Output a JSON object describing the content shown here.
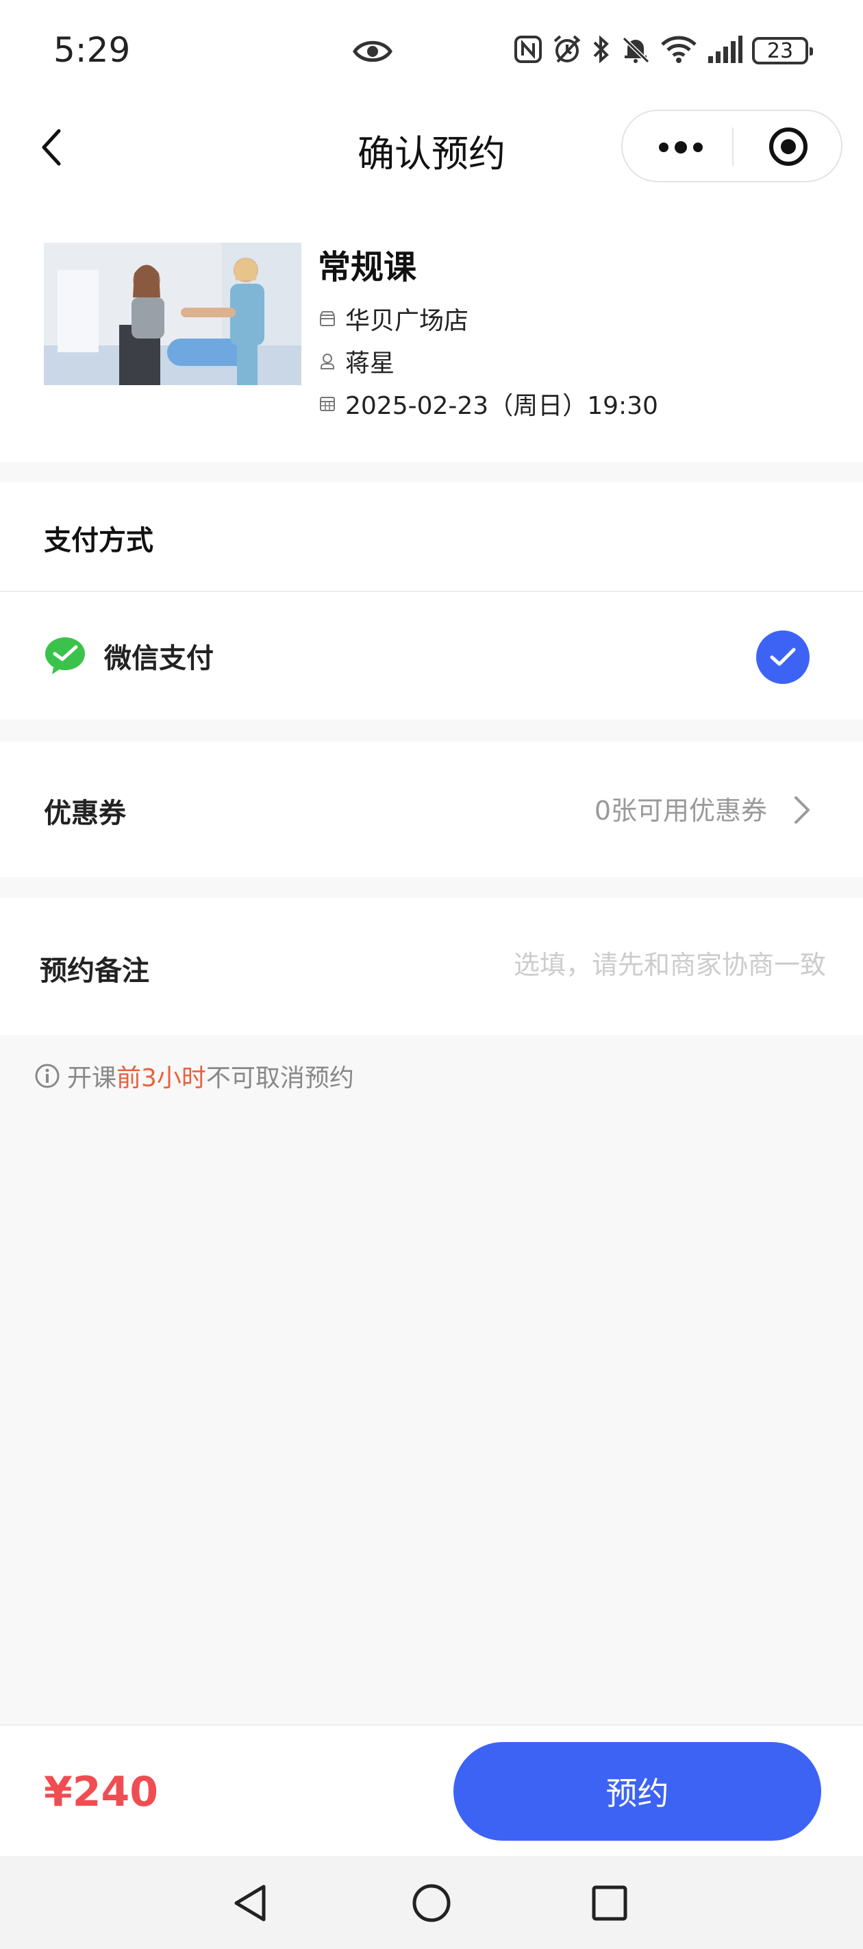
{
  "status_bar": {
    "time": "5:29",
    "battery": "23",
    "icons": [
      "eye-icon",
      "nfc-icon",
      "alarm-icon",
      "bluetooth-icon",
      "mute-icon",
      "wifi-icon",
      "signal-icon",
      "battery-icon"
    ]
  },
  "nav": {
    "title": "确认预约",
    "back_icon": "chevron-left-icon",
    "more_icon": "more-dots-icon",
    "close_icon": "target-icon"
  },
  "course": {
    "title": "常规课",
    "store": "华贝广场店",
    "coach": "蒋星",
    "datetime": "2025-02-23（周日）19:30"
  },
  "payment": {
    "section_title": "支付方式",
    "method": "微信支付",
    "selected": true,
    "accent": "#3d63f5",
    "wechat_color": "#3bc24a"
  },
  "coupon": {
    "label": "优惠券",
    "value": "0张可用优惠券"
  },
  "note": {
    "label": "预约备注",
    "placeholder": "选填，请先和商家协商一致",
    "value": ""
  },
  "tip": {
    "prefix": "开课",
    "highlight": "前3小时",
    "suffix": "不可取消预约",
    "highlight_color": "#e8613d"
  },
  "footer": {
    "price": "¥240",
    "price_color": "#ef4d52",
    "button_label": "预约"
  },
  "system_nav": [
    "back-triangle-icon",
    "home-circle-icon",
    "recent-square-icon"
  ]
}
